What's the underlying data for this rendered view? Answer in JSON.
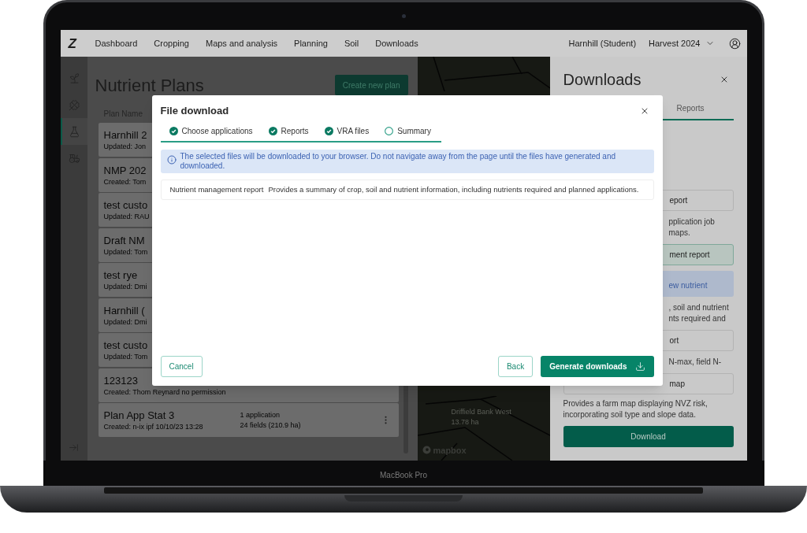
{
  "laptop": {
    "model": "MacBook Pro"
  },
  "header": {
    "logo": "Z",
    "nav": [
      {
        "label": "Dashboard"
      },
      {
        "label": "Cropping"
      },
      {
        "label": "Maps and analysis"
      },
      {
        "label": "Planning"
      },
      {
        "label": "Soil"
      },
      {
        "label": "Downloads"
      }
    ],
    "farm": "Harnhill (Student)",
    "season": "Harvest 2024"
  },
  "sidebar": {
    "items": [
      {
        "selected": false
      },
      {
        "selected": false
      },
      {
        "selected": true
      },
      {
        "selected": false
      }
    ]
  },
  "plans": {
    "title": "Nutrient Plans",
    "create_button": "Create new plan",
    "column": "Plan Name",
    "rows": [
      {
        "name": "Harnhill 2",
        "meta": "Updated: Jon"
      },
      {
        "name": "NMP 202",
        "meta": "Created: Tom"
      },
      {
        "name": "test custo",
        "meta": "Updated: RAU"
      },
      {
        "name": "Draft NM",
        "meta": "Updated: Tom"
      },
      {
        "name": "test rye",
        "meta": "Updated: Dmi"
      },
      {
        "name": "Harnhill (",
        "meta": "Updated: Dmi"
      },
      {
        "name": "test custo",
        "meta": "Updated: Tom"
      },
      {
        "name": "123123",
        "meta": "Created: Thom Reynard no permission"
      },
      {
        "name": "Plan App Stat 3",
        "meta": "Created: n-ix ipf 10/10/23 13:28",
        "applications": "1 application",
        "fields": "24 fields (210.9 ha)"
      }
    ]
  },
  "map": {
    "field_name": "Driffield Bank West",
    "field_area": "13.78 ha",
    "attribution": "mapbox"
  },
  "downloads_panel": {
    "title": "Downloads",
    "tabs": [
      {
        "label": "Reports",
        "selected": true
      }
    ],
    "items": [
      {
        "kind": "button",
        "label": "eport",
        "selected": false
      },
      {
        "kind": "fragment",
        "lines": [
          "pplication job",
          "maps."
        ]
      },
      {
        "kind": "button",
        "label": "ment report",
        "selected": true
      },
      {
        "kind": "info",
        "label": "ew nutrient"
      },
      {
        "kind": "fragment",
        "lines": [
          ", soil and nutrient",
          "nts required and"
        ]
      },
      {
        "kind": "button",
        "label": "ort",
        "selected": false
      },
      {
        "kind": "fragment",
        "lines": [
          "N-max, field N-"
        ]
      },
      {
        "kind": "button",
        "label": "map",
        "selected": false
      },
      {
        "kind": "paragraph",
        "text": "Provides a farm map displaying NVZ risk, incorporating soil type and slope data."
      },
      {
        "kind": "primary",
        "label": "Download"
      }
    ]
  },
  "modal": {
    "title": "File download",
    "steps": [
      {
        "label": "Choose applications",
        "done": true
      },
      {
        "label": "Reports",
        "done": true
      },
      {
        "label": "VRA files",
        "done": true
      },
      {
        "label": "Summary",
        "done": false
      }
    ],
    "notice": "The selected files will be downloaded to your browser. Do not navigate away from the page until the files have generated and downloaded.",
    "items": [
      {
        "name": "Nutrient management report",
        "description": "Provides a summary of crop, soil and nutrient information, including nutrients required and planned applications."
      }
    ],
    "cancel": "Cancel",
    "back": "Back",
    "generate": "Generate downloads"
  }
}
